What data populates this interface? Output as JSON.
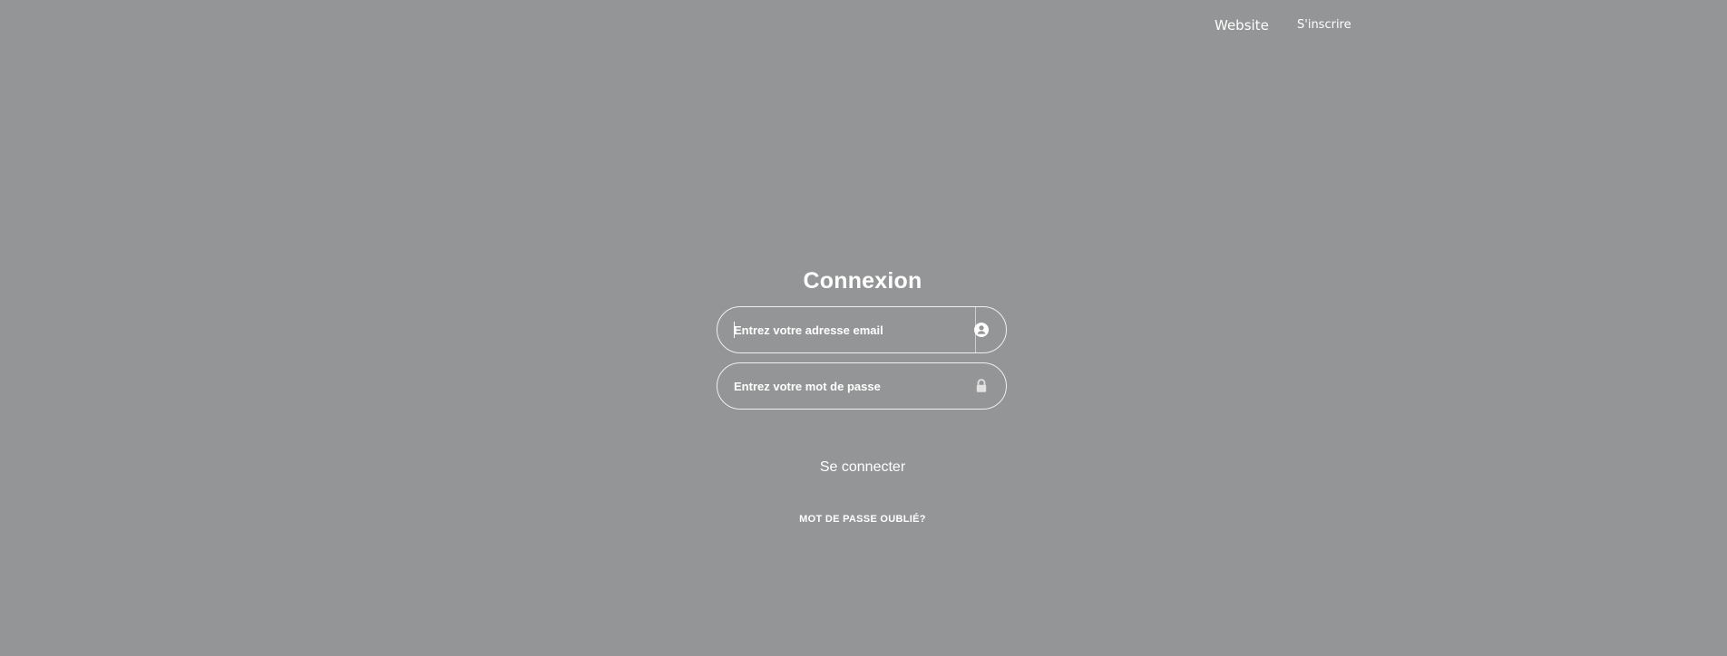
{
  "nav": {
    "website_label": "Website",
    "signup_label": "S'inscrire"
  },
  "login": {
    "title": "Connexion",
    "email": {
      "value": "",
      "placeholder": "Entrez votre adresse email",
      "icon": "user-circle-icon"
    },
    "password": {
      "value": "",
      "placeholder": "Entrez votre mot de passe",
      "icon": "lock-icon"
    },
    "submit_label": "Se connecter",
    "forgot_label": "MOT DE PASSE OUBLIÉ?"
  },
  "colors": {
    "background": "#949596",
    "text": "#ffffff",
    "border": "#ffffff"
  }
}
